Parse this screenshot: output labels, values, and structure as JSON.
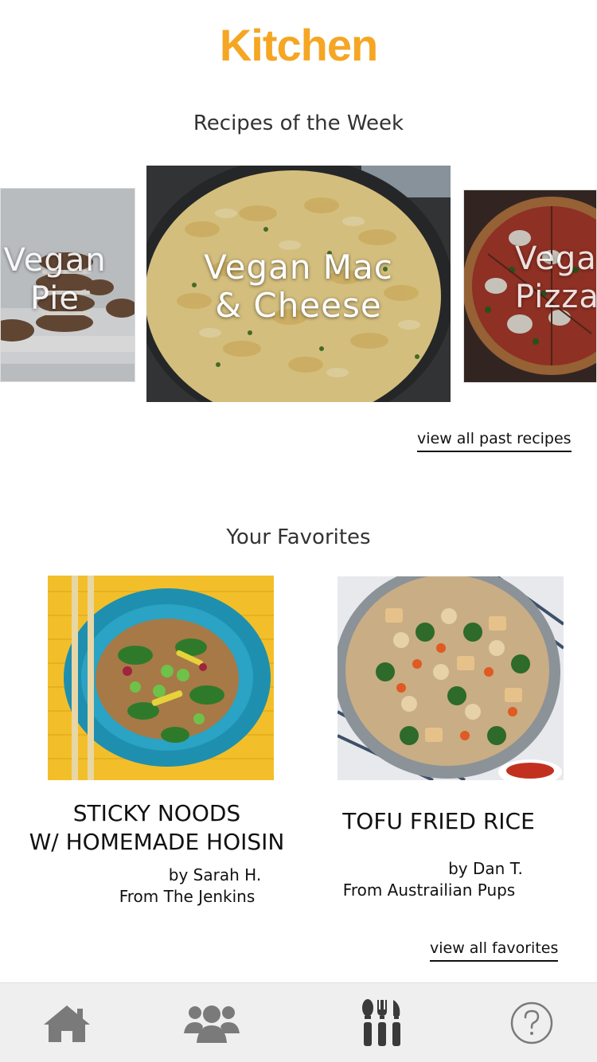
{
  "header": {
    "title": "Kitchen"
  },
  "recipes_of_week": {
    "title": "Recipes of the Week",
    "cards": [
      {
        "label": "Vegan\nPie"
      },
      {
        "label": "Vegan Mac\n& Cheese"
      },
      {
        "label": "Vegan\nPizza"
      }
    ],
    "view_all_label": "view all past recipes"
  },
  "favorites": {
    "title": "Your Favorites",
    "items": [
      {
        "title": "STICKY NOODS\nW/ HOMEMADE HOISIN",
        "by": "by Sarah H.",
        "from": "From The Jenkins"
      },
      {
        "title": "TOFU FRIED RICE",
        "by": "by Dan T.",
        "from": "From Austrailian Pups"
      }
    ],
    "view_all_label": "view all favorites"
  },
  "tab_bar": {
    "tabs": [
      {
        "icon": "home-icon"
      },
      {
        "icon": "community-icon"
      },
      {
        "icon": "utensils-icon"
      },
      {
        "icon": "help-icon"
      }
    ]
  },
  "colors": {
    "brand": "#F5A623",
    "tab_icon": "#7a7a7a",
    "tab_active": "#3a3a3a"
  }
}
